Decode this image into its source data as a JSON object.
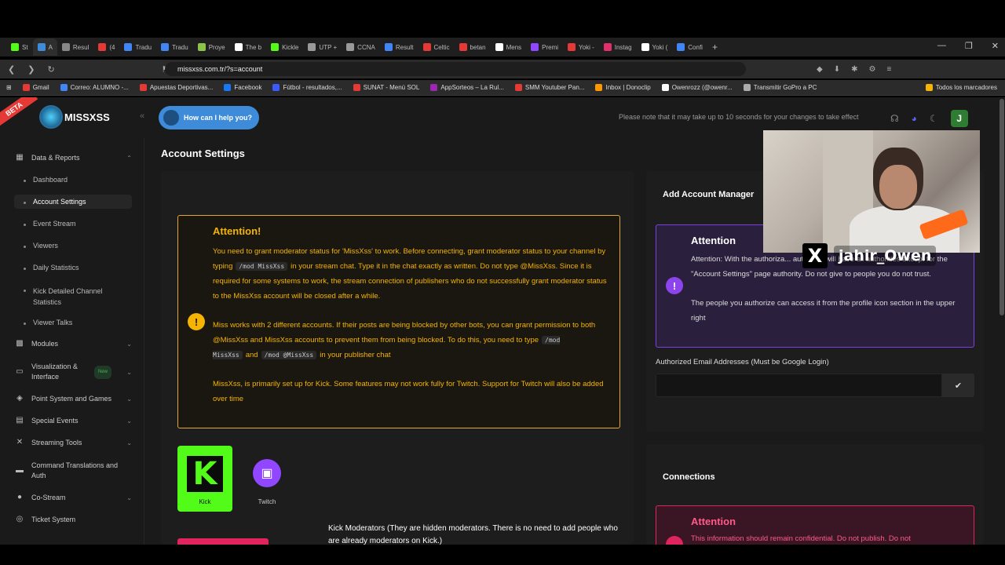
{
  "browser": {
    "tabs": [
      "St",
      "A",
      "Resul",
      "(4",
      "Tradu",
      "Tradu",
      "Proye",
      "The b",
      "Kickle",
      "UTP +",
      "CCNA",
      "Result",
      "Celtic",
      "betan",
      "Mens",
      "Premi",
      "Yoki -",
      "Instag",
      "Yoki (",
      "Confi"
    ],
    "tab_colors": [
      "#53fc18",
      "#3d8bd9",
      "#888",
      "#e53935",
      "#4285f4",
      "#4285f4",
      "#8bc34a",
      "#ffffff",
      "#53fc18",
      "#999",
      "#999",
      "#4285f4",
      "#e53935",
      "#e53935",
      "#ffffff",
      "#9146ff",
      "#e53935",
      "#e1306c",
      "#ffffff",
      "#4285f4"
    ],
    "new_tab": "+",
    "window_controls": [
      "—",
      "❐",
      "✕"
    ],
    "url": "missxss.com.tr/?s=account",
    "bookmarks": [
      "Gmail",
      "Correo: ALUMNO -...",
      "Apuestas Deportivas...",
      "Facebook",
      "Fútbol - resultados,...",
      "SUNAT - Menú SOL",
      "AppSorteos – La Rul...",
      "SMM Youtuber Pan...",
      "Inbox | Donoclip",
      "Owenrozz (@owenr...",
      "Transmitir GoPro a PC"
    ],
    "bookmark_colors": [
      "#e53935",
      "#4285f4",
      "#e53935",
      "#1877f2",
      "#3d5afe",
      "#e53935",
      "#9c27b0",
      "#e53935",
      "#ff9800",
      "#ffffff",
      "#aaaaaa"
    ],
    "bookmarks_all": "Todos los marcadores"
  },
  "header": {
    "beta": "BETA",
    "logo": "MISSXSS",
    "collapse": "«",
    "help": "How can I help you?",
    "notice": "Please note that it may take up to 10 seconds for your changes to take effect",
    "user_initial": "J"
  },
  "sidebar": {
    "section": "Data & Reports",
    "sub": [
      "Dashboard",
      "Account Settings",
      "Event Stream",
      "Viewers",
      "Daily Statistics",
      "Kick Detailed Channel Statistics",
      "Viewer Talks"
    ],
    "items": [
      "Modules",
      "Visualization & Interface",
      "Point System and Games",
      "Special Events",
      "Streaming Tools",
      "Command Translations and Auth",
      "Co-Stream",
      "Ticket System"
    ],
    "new_badge": "New"
  },
  "main": {
    "title": "Account Settings",
    "attention": {
      "title": "Attention!",
      "p1a": "You need to grant moderator status for 'MissXss' to work. Before connecting, grant moderator status to your channel by typing",
      "p1code": "/mod MissXss",
      "p1b": "in your stream chat. Type it in the chat exactly as written. Do not type @MissXss. Since it is required for some systems to work, the stream connection of publishers who do not successfully grant moderator status to the MissXss account will be closed after a while.",
      "p2a": "Miss works with 2 different accounts. If their posts are being blocked by other bots, you can grant permission to both @MissXss and MissXss accounts to prevent them from being blocked. To do this, you need to type",
      "p2code1": "/mod MissXss",
      "p2and": "and",
      "p2code2": "/mod @MissXss",
      "p2b": "in your publisher chat",
      "p3": "MissXss, is primarily set up for Kick. Some features may not work fully for Twitch. Support for Twitch will also be added over time"
    },
    "kick_label": "Kick",
    "twitch_label": "Twitch",
    "kick_mods": "Kick Moderators (They are hidden moderators. There is no need to add people who are already moderators on Kick.)"
  },
  "right": {
    "add_manager": "Add Account Manager",
    "attention_title": "Attention",
    "attention_p1": "Attention: With the authoriza... authorize will have all authorities except for the \"Account Settings\" page authority. Do not give to people you do not trust.",
    "attention_p2": "The people you authorize can access it from the profile icon section in the upper right",
    "email_label": "Authorized Email Addresses (Must be Google Login)",
    "email_value": "",
    "connections": "Connections",
    "conn_title": "Attention",
    "conn_body": "This information should remain confidential. Do not publish. Do not"
  },
  "overlay": {
    "handle": "jahir_Owen"
  }
}
